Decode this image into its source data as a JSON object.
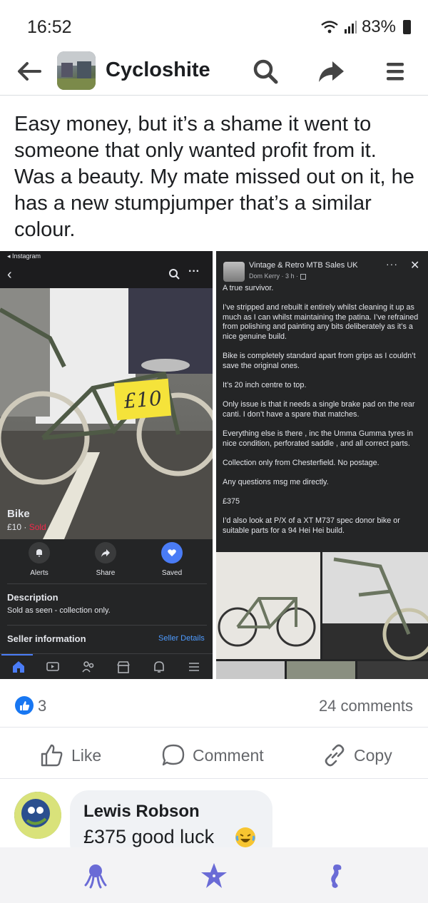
{
  "status_bar": {
    "time": "16:52",
    "battery": "83%"
  },
  "header": {
    "group_name": "Cycloshite"
  },
  "post": {
    "text": "Easy money, but it’s a shame it went to someone that only wanted profit from it. Was a beauty. My mate missed out on it, he has a new stumpjumper that’s a similar colour."
  },
  "left_screenshot": {
    "app_label": "◂ Instagram",
    "price_sign": "£10",
    "item_title": "Bike",
    "item_price": "£10 · ",
    "item_status": "Sold",
    "actions": [
      {
        "label": "Alerts",
        "icon": "bell-icon"
      },
      {
        "label": "Share",
        "icon": "share-icon"
      },
      {
        "label": "Saved",
        "icon": "heart-icon"
      }
    ],
    "description_heading": "Description",
    "description_text": "Sold as seen - collection only.",
    "seller_heading": "Seller information",
    "seller_link": "Seller Details"
  },
  "right_screenshot": {
    "group_name": "Vintage & Retro MTB Sales UK",
    "author": "Dom Kerry · 3 h · ",
    "body": [
      "A true survivor.",
      "I’ve stripped and rebuilt it entirely whilst cleaning it up as much as I can whilst maintaining the patina. I’ve refrained from polishing and painting any bits deliberately as it’s a nice genuine build.",
      "Bike is completely standard apart from grips as I couldn’t save the original ones.",
      "It’s 20 inch centre to top.",
      "Only issue is that it needs a single brake pad on the rear canti. I don’t have a spare that matches.",
      "Everything else is there , inc the Umma Gumma tyres in nice condition, perforated saddle , and all correct parts.",
      "Collection only from Chesterfield. No postage.",
      "Any questions msg me directly.",
      "£375",
      "I’d also look at P/X of a XT M737 spec donor bike or suitable parts for a 94 Hei Hei build."
    ]
  },
  "reactions": {
    "like_count": "3",
    "comments": "24 comments"
  },
  "actions": {
    "like": "Like",
    "comment": "Comment",
    "copy": "Copy"
  },
  "comment": {
    "name": "Lewis Robson",
    "text": "£375 good luck"
  },
  "colors": {
    "facebook_blue": "#1877f2",
    "sold_red": "#f02849",
    "dark_bg": "#242526",
    "nav_icon": "#6a6bd6"
  }
}
